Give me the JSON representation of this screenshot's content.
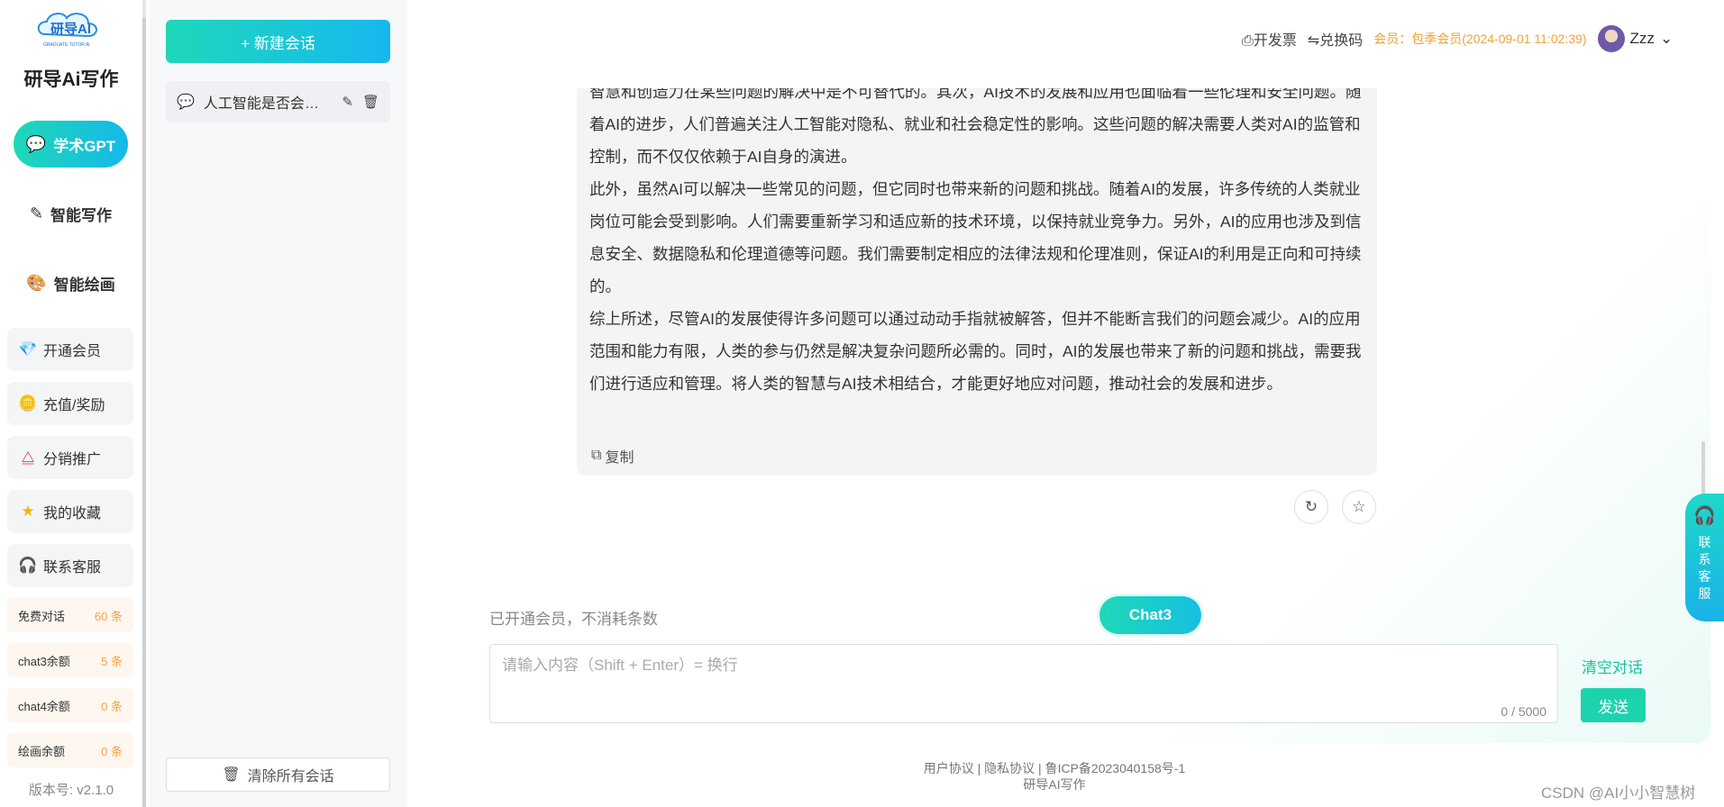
{
  "sidebar": {
    "logo_text": "研导AI",
    "app_title": "研导Ai写作",
    "main_items": [
      {
        "label": "学术GPT",
        "icon": "chat-bubble-icon",
        "active": true
      },
      {
        "label": "智能写作",
        "icon": "pencil-icon",
        "active": false
      },
      {
        "label": "智能绘画",
        "icon": "palette-icon",
        "active": false
      }
    ],
    "cards": [
      {
        "label": "开通会员",
        "icon": "diamond-icon"
      },
      {
        "label": "充值/奖励",
        "icon": "coin-icon"
      },
      {
        "label": "分销推广",
        "icon": "share-tree-icon"
      },
      {
        "label": "我的收藏",
        "icon": "star-icon"
      },
      {
        "label": "联系客服",
        "icon": "headset-icon"
      }
    ],
    "quotas": [
      {
        "label": "免费对话",
        "value": "60 条"
      },
      {
        "label": "chat3余额",
        "value": "5 条"
      },
      {
        "label": "chat4余额",
        "value": "0 条"
      },
      {
        "label": "绘画余额",
        "value": "0 条"
      }
    ],
    "version": "版本号: v2.1.0"
  },
  "conversations": {
    "new_button": "+ 新建会话",
    "items": [
      {
        "title": "人工智能是否会威胁人类"
      }
    ],
    "clear_all": "清除所有会话"
  },
  "header": {
    "invoice": "开发票",
    "redeem": "兑换码",
    "membership": "会员：包季会员(2024-09-01 11:02:39)",
    "username": "Zzz"
  },
  "chat": {
    "answer_paragraphs": [
      "智慧和创造力在某些问题的解决中是不可替代的。其次，AI技术的发展和应用也面临着一些伦理和安全问题。随着AI的进步，人们普遍关注人工智能对隐私、就业和社会稳定性的影响。这些问题的解决需要人类对AI的监管和控制，而不仅仅依赖于AI自身的演进。",
      "此外，虽然AI可以解决一些常见的问题，但它同时也带来新的问题和挑战。随着AI的发展，许多传统的人类就业岗位可能会受到影响。人们需要重新学习和适应新的技术环境，以保持就业竞争力。另外，AI的应用也涉及到信息安全、数据隐私和伦理道德等问题。我们需要制定相应的法律法规和伦理准则，保证AI的利用是正向和可持续的。",
      "综上所述，尽管AI的发展使得许多问题可以通过动动手指就被解答，但并不能断言我们的问题会减少。AI的应用范围和能力有限，人类的参与仍然是解决复杂问题所必需的。同时，AI的发展也带来了新的问题和挑战，需要我们进行适应和管理。将人类的智慧与AI技术相结合，才能更好地应对问题，推动社会的发展和进步。"
    ],
    "copy_label": "复制",
    "member_note": "已开通会员，不消耗条数",
    "model": "Chat3",
    "input_placeholder": "请输入内容（Shift + Enter）= 换行",
    "input_value": "",
    "counter": "0 / 5000",
    "clear_chat": "清空对话",
    "send": "发送"
  },
  "service_float": {
    "chars": [
      "联",
      "系",
      "客",
      "服"
    ]
  },
  "footer": {
    "links": "用户协议 | 隐私协议 | 鲁ICP备2023040158号-1",
    "brand": "研导AI写作"
  },
  "watermark": "CSDN @AI小小智慧树",
  "colors": {
    "accent": "#1dd3ae",
    "accent_blue": "#16b8e8",
    "member": "#f0a23a"
  }
}
